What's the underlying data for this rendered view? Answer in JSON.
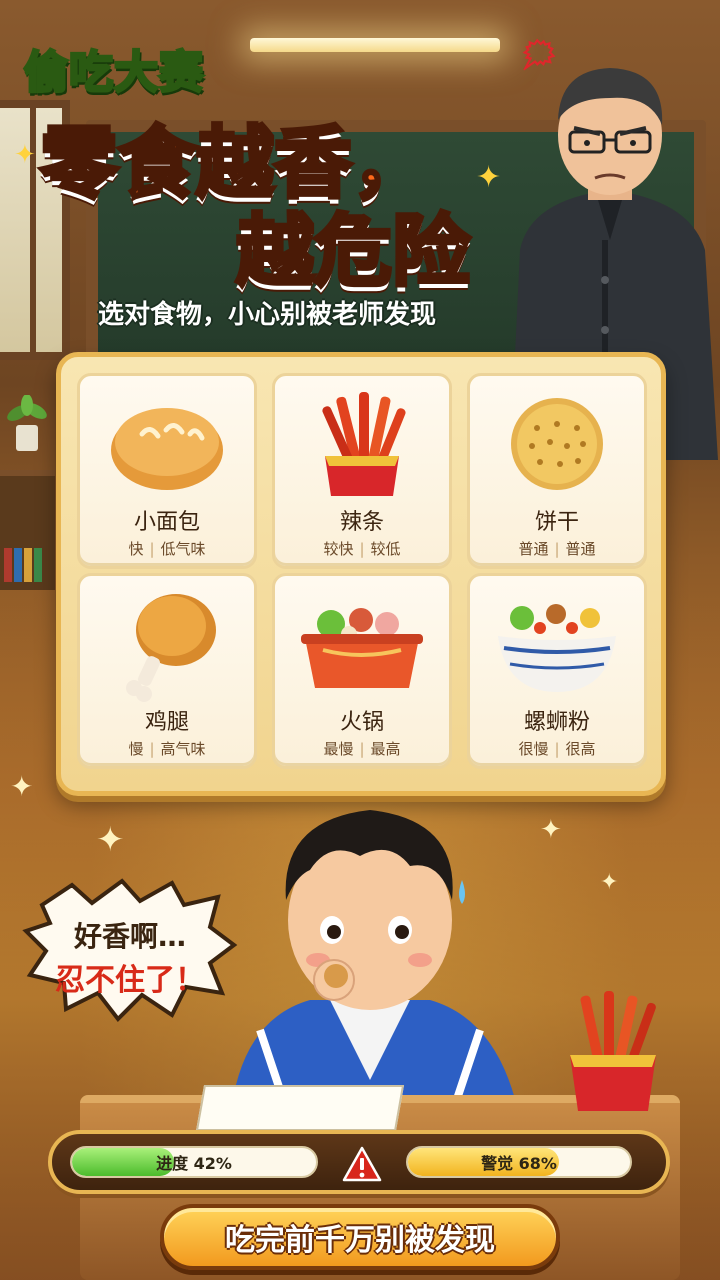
{
  "header": {
    "tag_title": "偷吃大赛",
    "headline_line1": "零食越香，",
    "headline_line2_a": "越",
    "headline_line2_b": "危险",
    "subline": "选对食物，小心别被老师发现"
  },
  "teacher": {
    "anger_mark": "🗯"
  },
  "foods": [
    {
      "name": "小面包",
      "speed": "快",
      "smell": "低气味",
      "icon": "bread-icon"
    },
    {
      "name": "辣条",
      "speed": "较快",
      "smell": "较低",
      "icon": "spicy-strips-icon"
    },
    {
      "name": "饼干",
      "speed": "普通",
      "smell": "普通",
      "icon": "cracker-icon"
    },
    {
      "name": "鸡腿",
      "speed": "慢",
      "smell": "高气味",
      "icon": "drumstick-icon"
    },
    {
      "name": "火锅",
      "speed": "最慢",
      "smell": "最高",
      "icon": "hotpot-icon"
    },
    {
      "name": "螺蛳粉",
      "speed": "很慢",
      "smell": "很高",
      "icon": "snail-noodles-icon"
    }
  ],
  "speech": {
    "line1": "好香啊…",
    "line2": "忍不住了！"
  },
  "hud": {
    "progress_label": "进度 42%",
    "progress_value": 0.42,
    "alert_label": "警觉 68%",
    "alert_value": 0.68,
    "warning_icon": "warning-icon"
  },
  "cta": {
    "label": "吃完前千万别被发现"
  },
  "colors": {
    "accent_orange": "#ff6a1a",
    "title_yellow": "#ffe14a",
    "panel_cream": "#f8e6b2",
    "progress_green": "#4cbc2c",
    "alert_yellow": "#f2b41f",
    "warning_red": "#d8261c"
  }
}
